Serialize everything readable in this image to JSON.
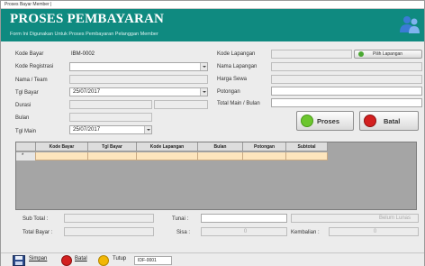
{
  "window": {
    "title": "Proses Bayar Member |"
  },
  "header": {
    "title": "PROSES PEMBAYARAN",
    "subtitle": "Form Ini Digunakan Untuk Proses Pembayaran Pelanggan Member"
  },
  "left_form": {
    "kode_bayar_label": "Kode Bayar",
    "kode_bayar_value": "IBM-0002",
    "kode_registrasi_label": "Kode Registrasi",
    "nama_team_label": "Nama / Team",
    "tgl_bayar_label": "Tgl Bayar",
    "tgl_bayar_value": "25/07/2017",
    "durasi_label": "Durasi",
    "bulan_label": "Bulan",
    "tgl_main_label": "Tgl Main",
    "tgl_main_value": "25/07/2017"
  },
  "right_form": {
    "kode_lapangan_label": "Kode Lapangan",
    "pilih_lapangan_label": "Pilih Lapangan",
    "nama_lapangan_label": "Nama Lapangan",
    "harga_sewa_label": "Harga Sewa",
    "potongan_label": "Potongan",
    "total_main_label": "Total Main / Bulan"
  },
  "actions": {
    "proses_label": "Proses",
    "batal_label": "Batal"
  },
  "grid": {
    "row_marker": "*",
    "columns": [
      "Kode Bayar",
      "Tgl Bayar",
      "Kode Lapangan",
      "Bulan",
      "Potongan",
      "Subtotal"
    ]
  },
  "totals": {
    "sub_total_label": "Sub Total :",
    "total_bayar_label": "Total Bayar :",
    "tunai_label": "Tunai :",
    "sisa_label": "Sisa :",
    "sisa_value": "0",
    "belum_lunas_label": "Belum Lunas",
    "kembalian_label": "Kembalian :",
    "kembalian_value": "0"
  },
  "toolbar": {
    "simpan_label": "Simpan",
    "batal_label": "Batal",
    "tutup_label": "Tutup",
    "id_value": "IDF-0001"
  },
  "colors": {
    "header": "#0f8a80",
    "grid_row": "#fde5bd",
    "proses_icon": "#6cc62e",
    "batal_icon": "#d32020",
    "tutup_icon": "#f2b705"
  }
}
